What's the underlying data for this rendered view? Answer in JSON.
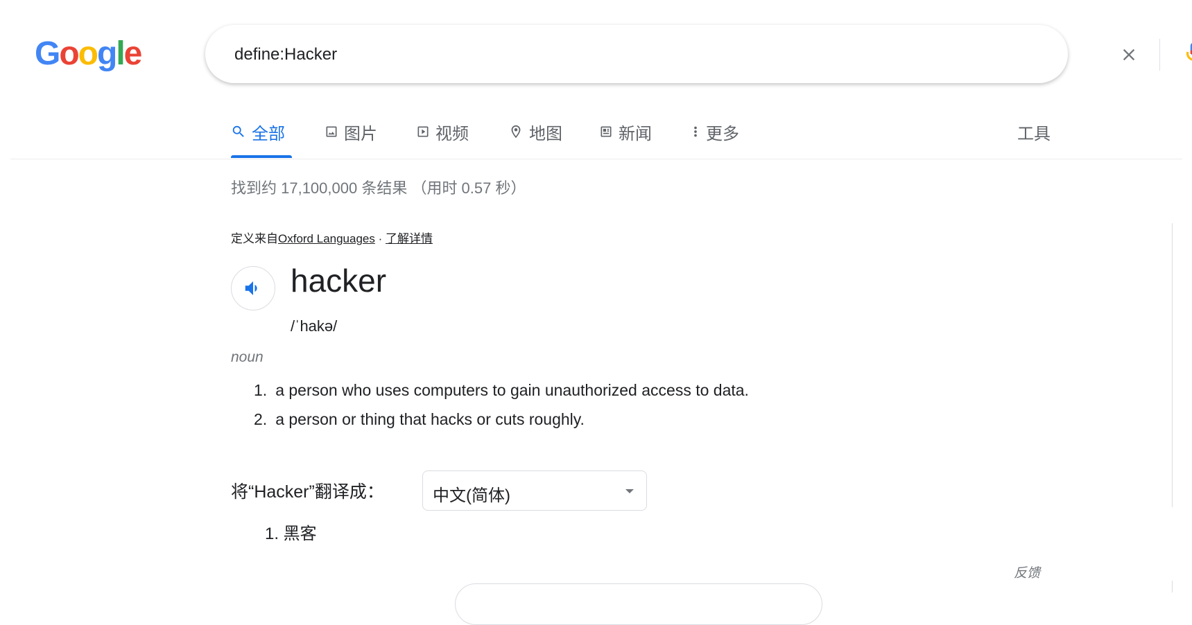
{
  "logo": {
    "letters": [
      "G",
      "o",
      "o",
      "g",
      "l",
      "e"
    ],
    "colors": [
      "#4285F4",
      "#EA4335",
      "#FBBC05",
      "#4285F4",
      "#34A853",
      "#EA4335"
    ]
  },
  "search": {
    "query": "define:Hacker"
  },
  "icons": {
    "clear": "close-icon",
    "mic": "mic-icon",
    "search": "search-icon"
  },
  "tabs": [
    {
      "label": "全部",
      "icon": "search-icon"
    },
    {
      "label": "图片",
      "icon": "image-icon"
    },
    {
      "label": "视频",
      "icon": "play-icon"
    },
    {
      "label": "地图",
      "icon": "map-pin-icon"
    },
    {
      "label": "新闻",
      "icon": "news-icon"
    },
    {
      "label": "更多",
      "icon": "more-vert-icon"
    }
  ],
  "tools_label": "工具",
  "result_stats": "找到约 17,100,000 条结果 （用时 0.57 秒）",
  "dictionary": {
    "source_prefix": "定义来自",
    "source_link": "Oxford Languages",
    "source_sep": " · ",
    "learn_more": "了解详情",
    "headword": "hacker",
    "phonetic": "/ˈhakə/",
    "part_of_speech": "noun",
    "definitions": [
      {
        "num": "1.",
        "text": "a person who uses computers to gain unauthorized access to data."
      },
      {
        "num": "2.",
        "text": "a person or thing that hacks or cuts roughly."
      }
    ]
  },
  "translate": {
    "label": "将“Hacker”翻译成：",
    "language": "中文(简体)",
    "result": "1. 黑客"
  },
  "feedback": "反馈",
  "colors": {
    "accent": "#1a73e8",
    "secondary_text": "#70757a"
  }
}
